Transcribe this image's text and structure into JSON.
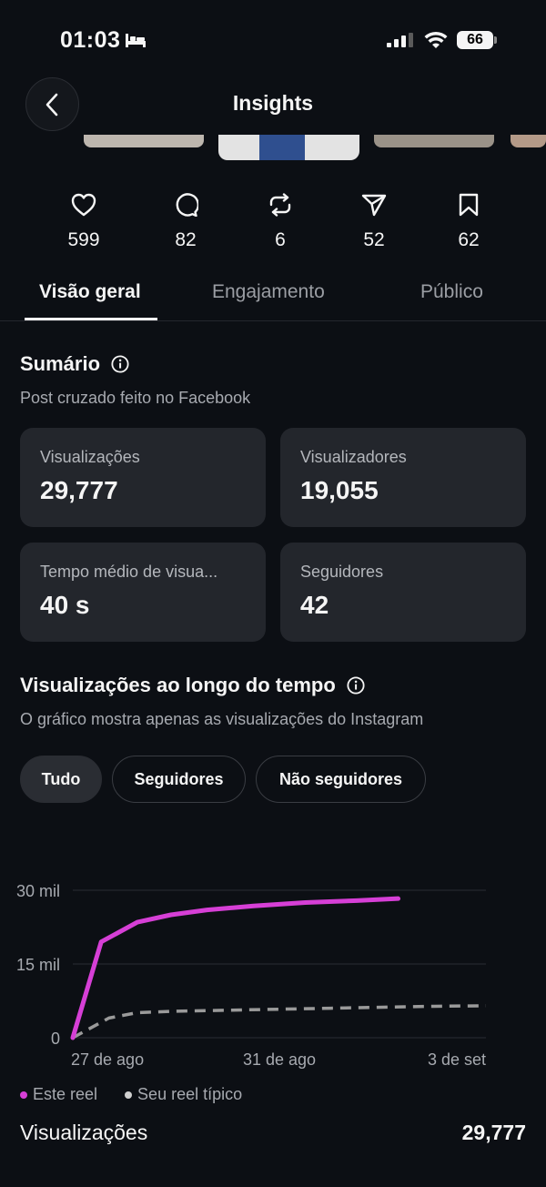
{
  "status_bar": {
    "time": "01:03",
    "battery": "66"
  },
  "header": {
    "title": "Insights"
  },
  "stats": [
    {
      "icon": "heart-icon",
      "value": "599"
    },
    {
      "icon": "comment-icon",
      "value": "82"
    },
    {
      "icon": "repost-icon",
      "value": "6"
    },
    {
      "icon": "share-icon",
      "value": "52"
    },
    {
      "icon": "bookmark-icon",
      "value": "62"
    }
  ],
  "tabs": [
    {
      "label": "Visão geral",
      "active": true
    },
    {
      "label": "Engajamento",
      "active": false
    },
    {
      "label": "Público",
      "active": false
    }
  ],
  "summary": {
    "title": "Sumário",
    "subtitle": "Post cruzado feito no Facebook",
    "cards": [
      {
        "label": "Visualizações",
        "value": "29,777"
      },
      {
        "label": "Visualizadores",
        "value": "19,055"
      },
      {
        "label": "Tempo médio de visua...",
        "value": "40 s"
      },
      {
        "label": "Seguidores",
        "value": "42"
      }
    ]
  },
  "views_over_time": {
    "title": "Visualizações ao longo do tempo",
    "subtitle": "O gráfico mostra apenas as visualizações do Instagram",
    "filters": [
      {
        "label": "Tudo",
        "active": true
      },
      {
        "label": "Seguidores",
        "active": false
      },
      {
        "label": "Não seguidores",
        "active": false
      }
    ]
  },
  "chart_data": {
    "type": "line",
    "x_ticks": [
      "27 de ago",
      "31 de ago",
      "3 de set"
    ],
    "y_ticks": [
      "0",
      "15 mil",
      "30 mil"
    ],
    "ylim": [
      0,
      30000
    ],
    "xlim": [
      0,
      8
    ],
    "grid": true,
    "legend_placement": "bottom-left",
    "series": [
      {
        "name": "Este reel",
        "color": "#d63fd6",
        "style": "solid",
        "x": [
          0,
          0.55,
          1.25,
          1.9,
          2.6,
          3.5,
          4.5,
          5.5,
          6.3
        ],
        "y": [
          0,
          19500,
          23500,
          25000,
          26000,
          26800,
          27500,
          27900,
          28300
        ]
      },
      {
        "name": "Seu reel típico",
        "color": "#9a9a9a",
        "style": "dashed",
        "x": [
          0,
          0.7,
          1.25,
          2.0,
          3.0,
          4.0,
          5.0,
          6.0,
          7.0,
          8.0
        ],
        "y": [
          0,
          4000,
          5100,
          5400,
          5600,
          5800,
          6000,
          6200,
          6400,
          6500
        ]
      }
    ]
  },
  "footer": {
    "label": "Visualizações",
    "value": "29,777"
  }
}
